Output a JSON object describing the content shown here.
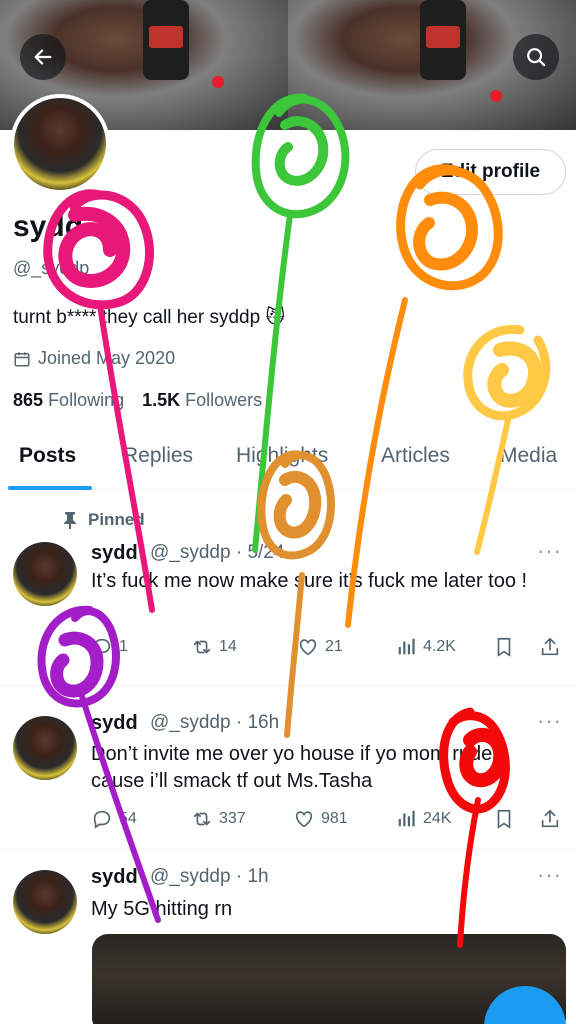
{
  "header": {
    "back_icon": "arrow-left-icon",
    "search_icon": "search-icon",
    "edit_profile_label": "Edit profile"
  },
  "profile": {
    "name": "sydd",
    "handle": "@_syddp",
    "bio": "turnt b**** they call her syddp 😼",
    "joined": "Joined May 2020",
    "following_count": "865",
    "following_label": "Following",
    "followers_count": "1.5K",
    "followers_label": "Followers"
  },
  "tabs": [
    {
      "label": "Posts"
    },
    {
      "label": "Replies"
    },
    {
      "label": "Highlights"
    },
    {
      "label": "Articles"
    },
    {
      "label": "Media"
    }
  ],
  "pinned_label": "Pinned",
  "posts": [
    {
      "name": "sydd",
      "meta": "@_syddp · 5/24",
      "text": "It’s fuck me now make sure it’s fuck me later too !",
      "replies": "1",
      "reposts": "14",
      "likes": "21",
      "views": "4.2K"
    },
    {
      "name": "sydd",
      "meta": "@_syddp · 16h",
      "text": "Don’t invite me over yo house if yo mom rude cause i’ll smack tf out Ms.Tasha",
      "replies": "54",
      "reposts": "337",
      "likes": "981",
      "views": "24K"
    },
    {
      "name": "sydd",
      "meta": "@_syddp · 1h",
      "text": "My 5G hitting rn"
    }
  ],
  "colors": {
    "accent": "#1d9bf0",
    "scribble_pink": "#e8177a",
    "scribble_green": "#3cc63a",
    "scribble_orange": "#ff8c0a",
    "scribble_yellow": "#ffc845",
    "scribble_tan": "#e0902e",
    "scribble_purple": "#a31ec8",
    "scribble_red": "#f20a0a"
  }
}
